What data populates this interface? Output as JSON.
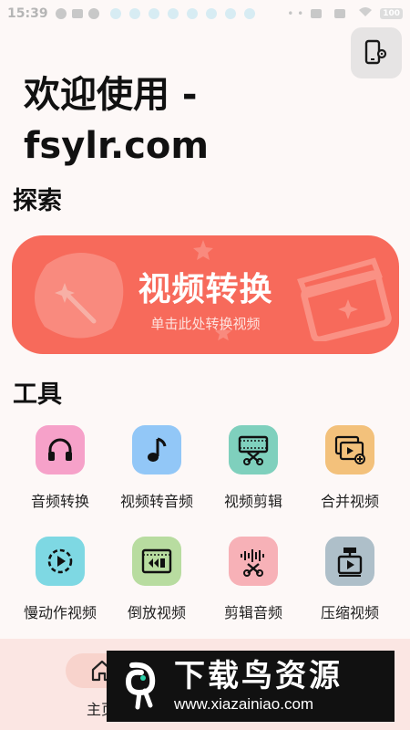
{
  "status_bar": {
    "time": "15:39",
    "battery": "100"
  },
  "welcome": {
    "line1": "欢迎使用 -",
    "line2": "fsylr.com"
  },
  "explore": {
    "title": "探索",
    "banner": {
      "title": "视频转换",
      "subtitle": "单击此处转换视频",
      "color": "#f76a5b"
    }
  },
  "tools": {
    "title": "工具",
    "items": [
      {
        "label": "音频转换",
        "icon": "headphones-icon",
        "bg": "#f6a1c9"
      },
      {
        "label": "视频转音频",
        "icon": "music-note-icon",
        "bg": "#92c7f7"
      },
      {
        "label": "视频剪辑",
        "icon": "film-scissors-icon",
        "bg": "#7fd0bd"
      },
      {
        "label": "合并视频",
        "icon": "merge-video-icon",
        "bg": "#f3c17b"
      },
      {
        "label": "慢动作视频",
        "icon": "slow-motion-icon",
        "bg": "#7ed8e3"
      },
      {
        "label": "倒放视频",
        "icon": "reverse-video-icon",
        "bg": "#b8dca0"
      },
      {
        "label": "剪辑音频",
        "icon": "audio-scissors-icon",
        "bg": "#f7b1b7"
      },
      {
        "label": "压缩视频",
        "icon": "compress-video-icon",
        "bg": "#aebfc9"
      }
    ]
  },
  "bottom_nav": {
    "home_label": "主页"
  },
  "watermark": {
    "title": "下载鸟资源",
    "url": "www.xiazainiao.com"
  }
}
